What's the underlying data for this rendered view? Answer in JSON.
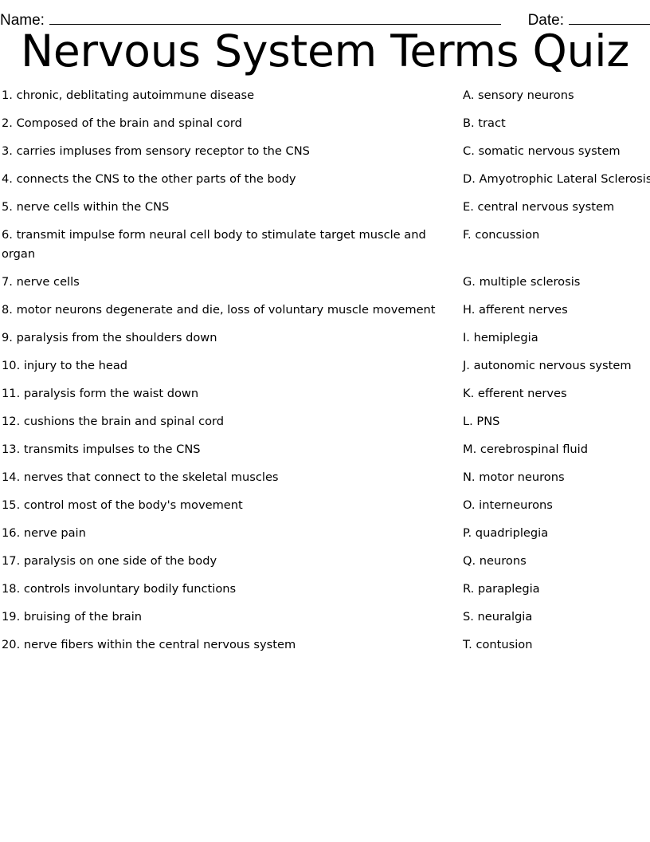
{
  "header": {
    "name_label": "Name:",
    "date_label": "Date:"
  },
  "title": "Nervous System Terms Quiz",
  "questions": [
    {
      "text": "1. chronic, deblitating autoimmune disease"
    },
    {
      "text": "2. Composed of the brain and spinal cord"
    },
    {
      "text": "3. carries impluses from sensory receptor to the CNS"
    },
    {
      "text": "4. connects the CNS to the other parts of the body"
    },
    {
      "text": "5. nerve cells within the CNS"
    },
    {
      "text": "6. transmit impulse form neural cell body to stimulate target muscle and organ"
    },
    {
      "text": "7. nerve cells"
    },
    {
      "text": "8. motor neurons degenerate and die, loss of voluntary muscle movement"
    },
    {
      "text": "9. paralysis from the shoulders down"
    },
    {
      "text": "10. injury to the head"
    },
    {
      "text": "11. paralysis form the waist down"
    },
    {
      "text": "12. cushions the brain and spinal cord"
    },
    {
      "text": "13. transmits impulses to the CNS"
    },
    {
      "text": "14. nerves that connect to the skeletal muscles"
    },
    {
      "text": "15. control most of the body's movement"
    },
    {
      "text": "16. nerve pain"
    },
    {
      "text": "17. paralysis on one side of the body"
    },
    {
      "text": "18. controls involuntary bodily functions"
    },
    {
      "text": "19. bruising of the brain"
    },
    {
      "text": "20. nerve fibers within the central nervous system"
    }
  ],
  "answers": [
    {
      "text": "A. sensory neurons"
    },
    {
      "text": "B. tract"
    },
    {
      "text": "C. somatic nervous system"
    },
    {
      "text": "D. Amyotrophic Lateral Sclerosis"
    },
    {
      "text": "E. central nervous system"
    },
    {
      "text": "F. concussion"
    },
    {
      "text": "G. multiple sclerosis"
    },
    {
      "text": "H. afferent nerves"
    },
    {
      "text": "I. hemiplegia"
    },
    {
      "text": "J. autonomic nervous system"
    },
    {
      "text": "K. efferent nerves"
    },
    {
      "text": "L. PNS"
    },
    {
      "text": "M. cerebrospinal fluid"
    },
    {
      "text": "N. motor neurons"
    },
    {
      "text": "O. interneurons"
    },
    {
      "text": "P. quadriplegia"
    },
    {
      "text": "Q. neurons"
    },
    {
      "text": "R. paraplegia"
    },
    {
      "text": "S. neuralgia"
    },
    {
      "text": "T. contusion"
    }
  ]
}
